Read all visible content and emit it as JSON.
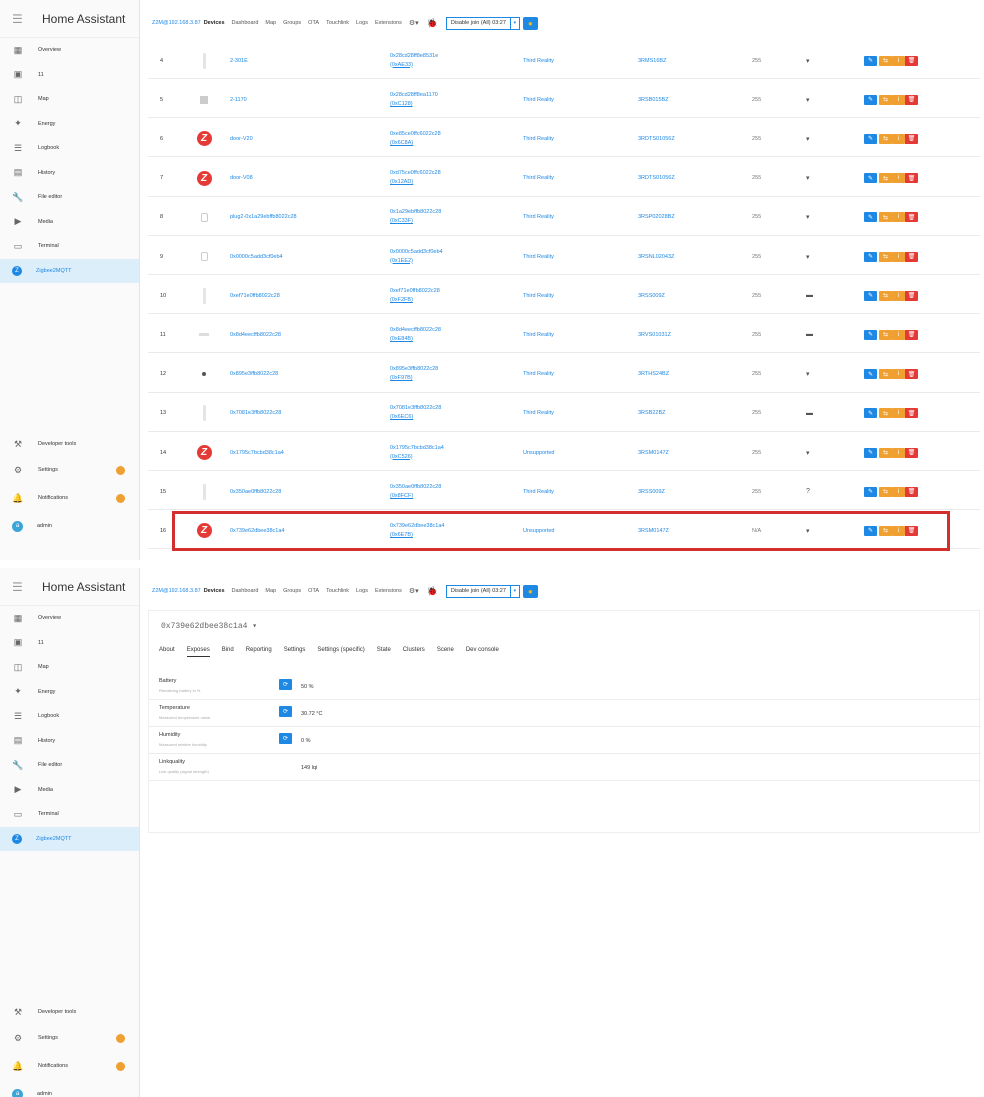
{
  "app": {
    "title": "Home Assistant",
    "sidebar": {
      "items": [
        {
          "label": "Overview",
          "icon": "grid-icon"
        },
        {
          "label": "11",
          "icon": "account-box-icon"
        },
        {
          "label": "Map",
          "icon": "map-icon"
        },
        {
          "label": "Energy",
          "icon": "lightning-icon"
        },
        {
          "label": "Logbook",
          "icon": "list-icon"
        },
        {
          "label": "History",
          "icon": "chart-box-icon"
        },
        {
          "label": "File editor",
          "icon": "wrench-icon"
        },
        {
          "label": "Media",
          "icon": "play-box-icon"
        },
        {
          "label": "Terminal",
          "icon": "console-icon"
        },
        {
          "label": "Zigbee2MQTT",
          "icon": "zigbee-icon",
          "active": true
        }
      ],
      "bottom": {
        "developer_tools": "Developer tools",
        "settings": "Settings",
        "notifications": "Notifications",
        "user": "admin",
        "user_initial": "a"
      }
    }
  },
  "topbar": {
    "host": "Z2M@192.168.3.87",
    "nav": [
      "Devices",
      "Dashboard",
      "Map",
      "Groups",
      "OTA",
      "Touchlink",
      "Logs",
      "Extensions"
    ],
    "active_nav": "Devices",
    "permit_join": "Disable join (All) 03:27",
    "caret": "▾",
    "gear": "⚙▾",
    "perm_icon": "🐞"
  },
  "devices": [
    {
      "n": "4",
      "pic": "strip",
      "name": "2-301E",
      "ieee": "0x28cd28ff8e8531e",
      "nwk": "(0xAE33)",
      "vendor": "Third Reality",
      "model": "3RMS16BZ",
      "lqi": "255",
      "power": "battery"
    },
    {
      "n": "5",
      "pic": "box",
      "name": "2-1170",
      "ieee": "0x28cd28ff8ea1170",
      "nwk": "(0xC128)",
      "vendor": "Third Reality",
      "model": "3RSB015BZ",
      "lqi": "255",
      "power": "battery"
    },
    {
      "n": "6",
      "pic": "zigbee",
      "name": "door-V20",
      "ieee": "0xe85ce0ffc6022c28",
      "nwk": "(0x6C8A)",
      "vendor": "Third Reality",
      "model": "3RDTS01056Z",
      "lqi": "255",
      "power": "battery"
    },
    {
      "n": "7",
      "pic": "zigbee",
      "name": "door-V08",
      "ieee": "0xd75ce0ffc6022c28",
      "nwk": "(0x12AD)",
      "vendor": "Third Reality",
      "model": "3RDTS01056Z",
      "lqi": "255",
      "power": "battery"
    },
    {
      "n": "8",
      "pic": "plug",
      "name": "plug2-0x1a29ebffb8022c28",
      "ieee": "0x1a29ebffb8022c28",
      "nwk": "(0xC33F)",
      "vendor": "Third Reality",
      "model": "3RSP02028BZ",
      "lqi": "255",
      "power": "battery"
    },
    {
      "n": "9",
      "pic": "plug",
      "name": "0x0000c5add3cf0eb4",
      "ieee": "0x0000c5add3cf0eb4",
      "nwk": "(0x1EE2)",
      "vendor": "Third Reality",
      "model": "3RSNL02043Z",
      "lqi": "255",
      "power": "battery"
    },
    {
      "n": "10",
      "pic": "strip",
      "name": "0xef71e0ffb8022c28",
      "ieee": "0xef71e0ffb8022c28",
      "nwk": "(0xF2FB)",
      "vendor": "Third Reality",
      "model": "3RSS009Z",
      "lqi": "255",
      "power": "mains"
    },
    {
      "n": "11",
      "pic": "sensor",
      "name": "0x8d4eecffb8022c28",
      "ieee": "0x8d4eecffb8022c28",
      "nwk": "(0xE84B)",
      "vendor": "Third Reality",
      "model": "3RVS01031Z",
      "lqi": "255",
      "power": "mains"
    },
    {
      "n": "12",
      "pic": "dot",
      "name": "0x895e3ffb8022c28",
      "ieee": "0x895e3ffb8022c28",
      "nwk": "(0xF97B)",
      "vendor": "Third Reality",
      "model": "3RTHS24BZ",
      "lqi": "255",
      "power": "battery"
    },
    {
      "n": "13",
      "pic": "strip",
      "name": "0x7081e3ffb8022c28",
      "ieee": "0x7081e3ffb8022c28",
      "nwk": "(0x6EC6)",
      "vendor": "Third Reality",
      "model": "3RSB22BZ",
      "lqi": "255",
      "power": "mains"
    },
    {
      "n": "14",
      "pic": "zigbee",
      "name": "0x1795c7bcbd38c1a4",
      "ieee": "0x1795c7bcbd38c1a4",
      "nwk": "(0xC526)",
      "vendor": "Unsupported",
      "model": "3RSM0147Z",
      "lqi": "255",
      "power": "battery"
    },
    {
      "n": "15",
      "pic": "strip",
      "name": "0x350ae0ffb8022c28",
      "ieee": "0x350ae0ffb8022c28",
      "nwk": "(0x8FCF)",
      "vendor": "Third Reality",
      "model": "3RSS009Z",
      "lqi": "255",
      "power": "unknown"
    },
    {
      "n": "16",
      "pic": "zigbee",
      "name": "0x739e62dbee38c1a4",
      "ieee": "0x739e62dbee38c1a4",
      "nwk": "(0x6E7B)",
      "vendor": "Unsupported",
      "model": "3RSM0147Z",
      "lqi": "N/A",
      "power": "battery"
    }
  ],
  "glyphs": {
    "battery": "▾",
    "mains": "▬",
    "unknown": "?",
    "edit": "✎",
    "rename": "⇆",
    "info": "i",
    "delete": "🗑",
    "z": "Z",
    "config": "⟳"
  },
  "detail": {
    "device_title": "0x739e62dbee38c1a4 ▾",
    "tabs": [
      "About",
      "Exposes",
      "Bind",
      "Reporting",
      "Settings",
      "Settings (specific)",
      "State",
      "Clusters",
      "Scene",
      "Dev console"
    ],
    "active_tab": "Exposes",
    "exposes": [
      {
        "name": "Battery",
        "desc": "Remaining battery in %",
        "value": "50 %",
        "button": true
      },
      {
        "name": "Temperature",
        "desc": "Measured temperature value",
        "value": "30.72 °C",
        "button": true
      },
      {
        "name": "Humidity",
        "desc": "Measured relative humidity",
        "value": "0 %",
        "button": true
      },
      {
        "name": "Linkquality",
        "desc": "Link quality (signal strength)",
        "value": "149 lqi",
        "button": false
      }
    ]
  },
  "colors": {
    "accent": "#1e88e5",
    "highlight": "#d32f2f",
    "zigbee_red": "#e53935",
    "warn": "#f0a030"
  }
}
